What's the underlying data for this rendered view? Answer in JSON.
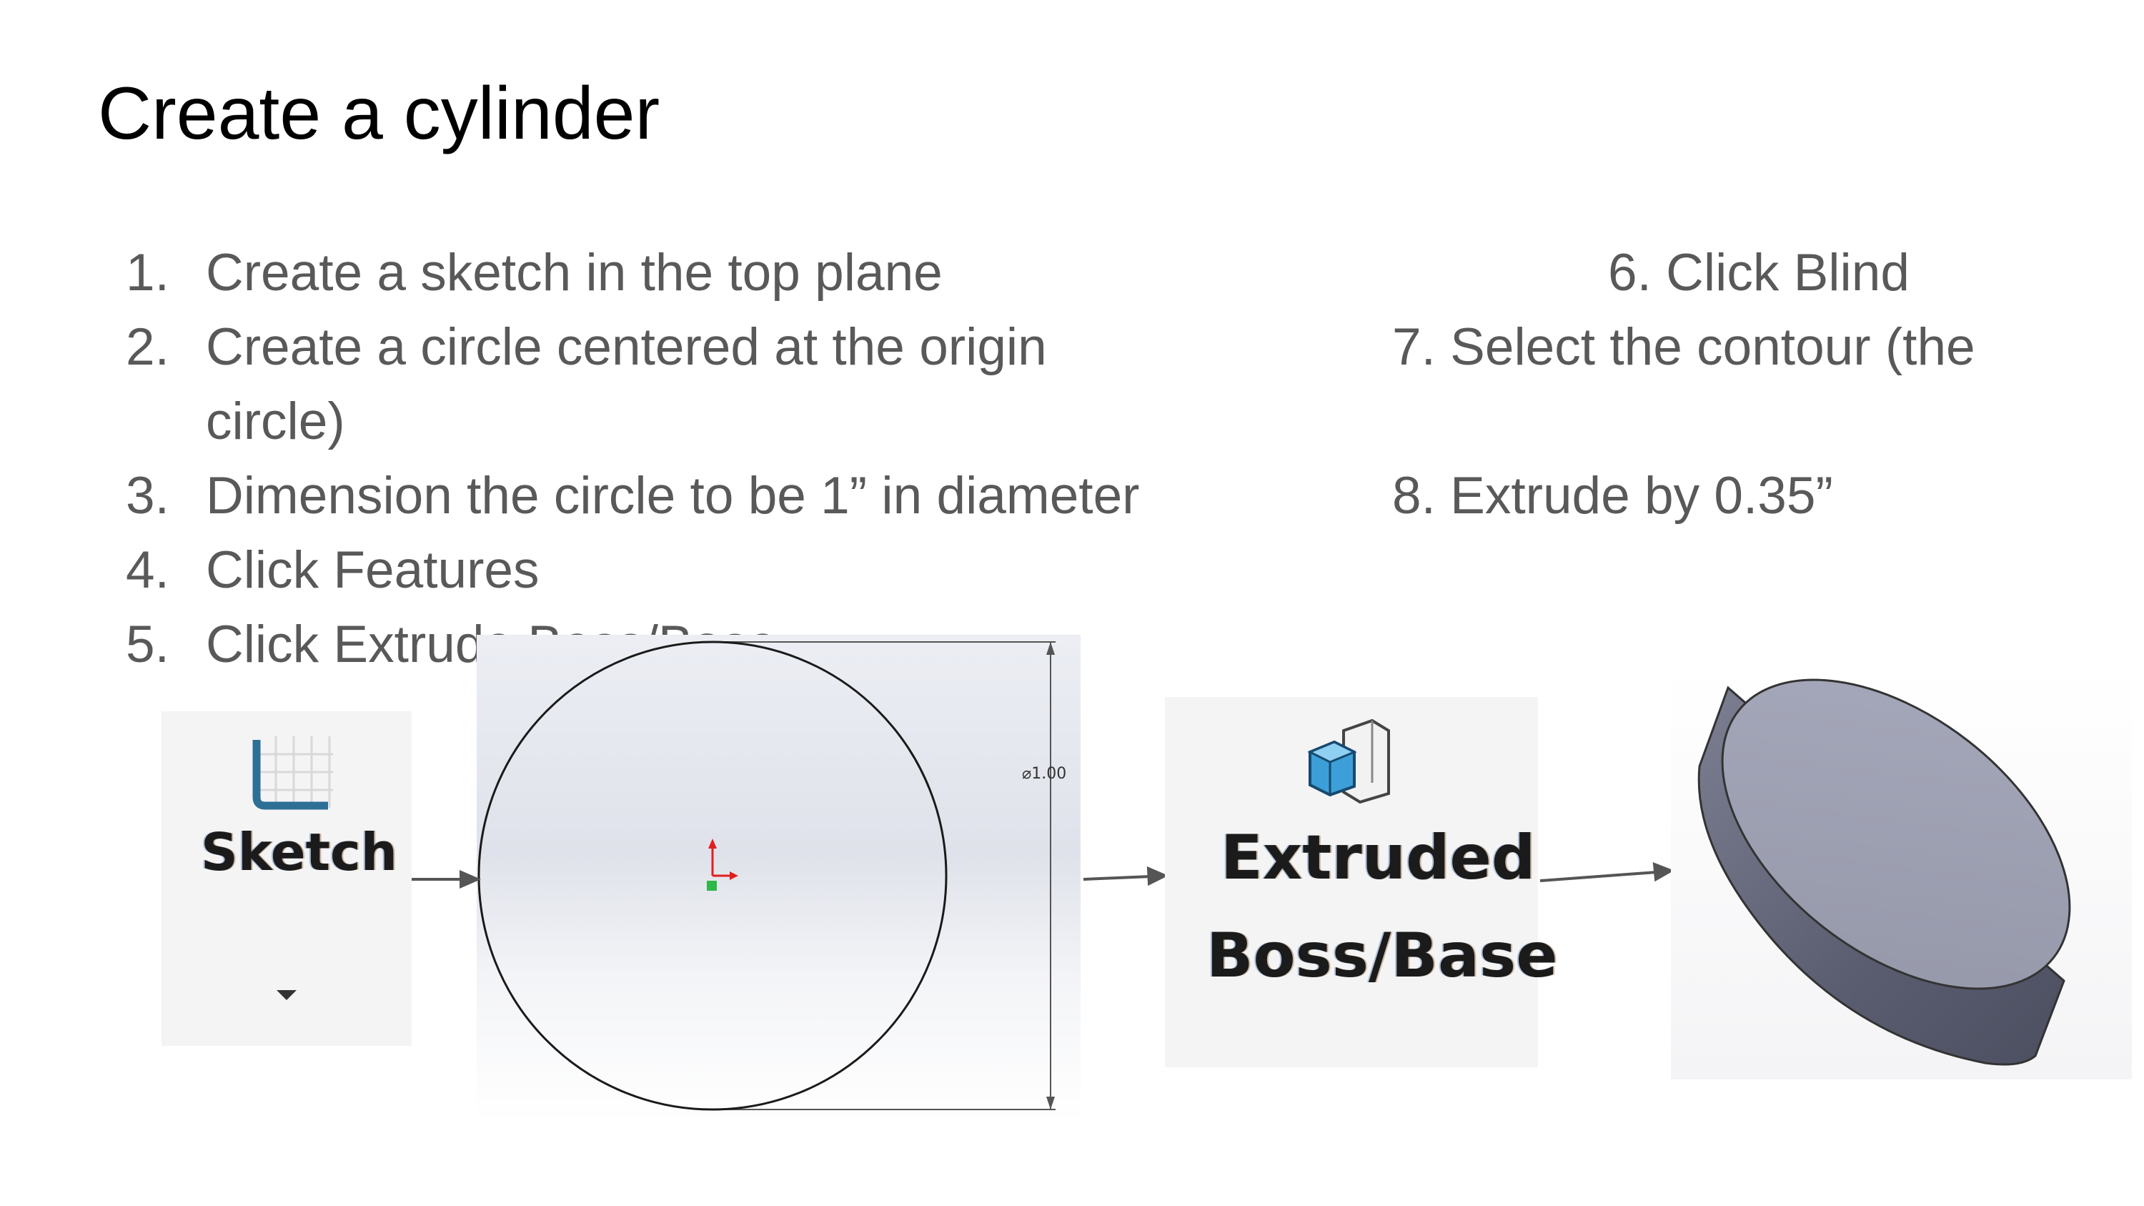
{
  "slide": {
    "title": "Create a cylinder"
  },
  "steps_left": [
    {
      "num": "1.",
      "text": "Create a sketch in the top plane"
    },
    {
      "num": "2.",
      "text": "Create a circle centered at the origin"
    },
    {
      "num": "",
      "text": "circle)"
    },
    {
      "num": "3.",
      "text": "Dimension the circle to be 1” in diameter"
    },
    {
      "num": "4.",
      "text": "Click Features"
    },
    {
      "num": "5.",
      "text": "Click Extrude Boss/Base"
    }
  ],
  "steps_right": [
    {
      "text": "6. Click Blind"
    },
    {
      "text": "7. Select the contour (the"
    },
    {
      "text": "8. Extrude by 0.35”"
    }
  ],
  "figures": {
    "sketch_tool": {
      "label": "Sketch",
      "icon": "sketch-icon"
    },
    "sketch_canvas": {
      "dimension": "⌀1.00"
    },
    "extrude_tool": {
      "label_line1": "Extruded",
      "label_line2": "Boss/Base",
      "icon": "extruded-boss-icon"
    },
    "result": {
      "icon": "cylinder-model"
    }
  },
  "colors": {
    "title": "#000000",
    "body_text": "#595959",
    "panel_bg": "#f4f4f4",
    "cylinder_top": "#9a9db0",
    "cylinder_side": "#63667a"
  }
}
